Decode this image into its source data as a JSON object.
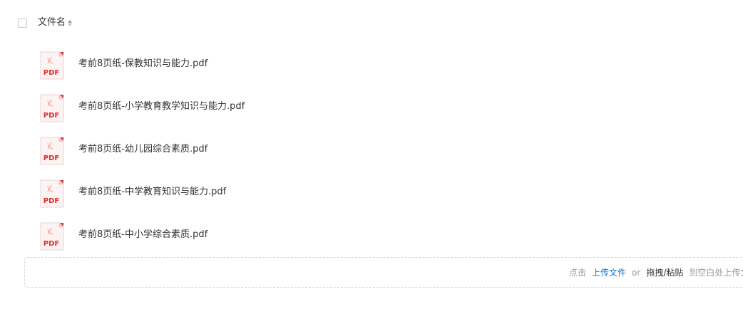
{
  "header": {
    "column_label": "文件名"
  },
  "files": [
    {
      "name": "考前8页纸-保教知识与能力.pdf",
      "icon_text": "PDF"
    },
    {
      "name": "考前8页纸-小学教育教学知识与能力.pdf",
      "icon_text": "PDF"
    },
    {
      "name": "考前8页纸-幼儿园综合素质.pdf",
      "icon_text": "PDF"
    },
    {
      "name": "考前8页纸-中学教育知识与能力.pdf",
      "icon_text": "PDF"
    },
    {
      "name": "考前8页纸-中小学综合素质.pdf",
      "icon_text": "PDF"
    }
  ],
  "upload": {
    "click_text": "点击",
    "upload_link": "上传文件",
    "or_text": "or",
    "drag_text": "拖拽/粘贴",
    "blank_text": "到空白处上传文件"
  },
  "colors": {
    "pdf_red": "#d9302f",
    "link_blue": "#1a6fc7"
  },
  "icons": {
    "file_icon": "pdf-file-icon",
    "sort_icon": "sort-icon"
  }
}
